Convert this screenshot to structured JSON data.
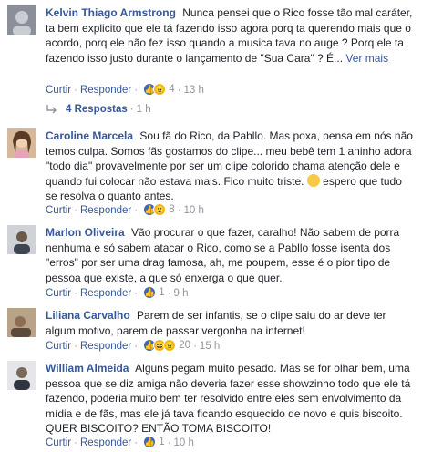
{
  "comments": [
    {
      "author": "Kelvin Thiago Armstrong",
      "text": "Nunca pensei que o Rico fosse tão mal caráter, ta bem explicito que ele tá fazendo isso agora porq ta querendo mais que o acordo, porq ele não fez isso quando a musica tava no auge ? Porq ele ta fazendo isso justo durante o lançamento de \"Sua Cara\" ? É...",
      "see_more": "Ver mais",
      "curtir": "Curtir",
      "responder": "Responder",
      "reactions": [
        "like-icon",
        "angry-icon"
      ],
      "reaction_count": "4",
      "time": "13 h",
      "replies": {
        "label": "4 Respostas",
        "time": "1 h"
      }
    },
    {
      "author": "Caroline Marcela",
      "text": "Sou fã do Rico, da Pabllo. Mas poxa, pensa em nós não temos culpa. Somos fãs gostamos do clipe... meu bebê tem 1 aninho adora \"todo dia\" provavelmente por ser um clipe colorido chama atenção dele e quando fui colocar não estava mais. Fico muito triste.",
      "text_after_emoji": "espero que tudo se resolva o quanto antes.",
      "curtir": "Curtir",
      "responder": "Responder",
      "reactions": [
        "like-icon",
        "wow-icon"
      ],
      "reaction_count": "8",
      "time": "10 h"
    },
    {
      "author": "Marlon Oliveira",
      "text": "Vão procurar o que fazer, caralho! Não sabem de porra nenhuma e só sabem atacar o Rico, como se a Pabllo fosse isenta dos \"erros\" por ser uma drag famosa, ah, me poupem, esse é o pior tipo de pessoa que existe, a que só enxerga o que quer.",
      "curtir": "Curtir",
      "responder": "Responder",
      "reactions": [
        "like-icon"
      ],
      "reaction_count": "1",
      "time": "9 h"
    },
    {
      "author": "Liliana Carvalho",
      "text": "Parem de ser infantis, se o clipe saiu do ar deve ter algum motivo, parem de passar vergonha na internet!",
      "curtir": "Curtir",
      "responder": "Responder",
      "reactions": [
        "like-icon",
        "haha-icon",
        "angry-icon"
      ],
      "reaction_count": "20",
      "time": "15 h"
    },
    {
      "author": "William Almeida",
      "text": "Alguns pegam muito pesado. Mas se for olhar bem, uma pessoa que se diz amiga não deveria fazer esse showzinho todo que ele tá fazendo, poderia muito bem ter resolvido entre eles sem envolvimento da mídia e de fãs, mas ele já tava ficando esquecido de novo e quis biscoito. QUER BISCOITO? ENTÃO TOMA BISCOITO!",
      "curtir": "Curtir",
      "responder": "Responder",
      "reactions": [
        "like-icon"
      ],
      "reaction_count": "1",
      "time": "10 h"
    }
  ],
  "colors": {
    "link": "#365899",
    "text": "#1d2129",
    "meta": "#90949c",
    "like": "#4267b2",
    "divider": "#e9ebee"
  }
}
